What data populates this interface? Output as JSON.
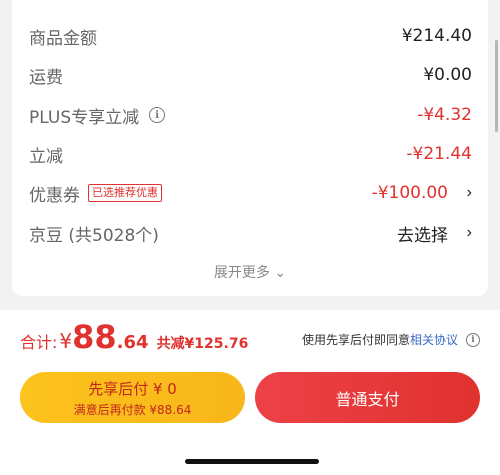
{
  "summary": {
    "rows": [
      {
        "label": "商品金额",
        "value": "¥214.40"
      },
      {
        "label": "运费",
        "value": "¥0.00"
      },
      {
        "label": "PLUS专享立减",
        "value": "-¥4.32"
      },
      {
        "label": "立减",
        "value": "-¥21.44"
      },
      {
        "label": "优惠券",
        "badge": "已选推荐优惠",
        "value": "-¥100.00",
        "chevron": "›"
      },
      {
        "label": "京豆 (共5028个)",
        "value": "去选择",
        "chevron": "›"
      }
    ],
    "expand_label": "展开更多 ⌄"
  },
  "footer": {
    "total_label": "合计:",
    "currency": "¥",
    "total_int": "88",
    "total_dec": ".64",
    "saved_text": "共减¥125.76",
    "agree_prefix": "使用先享后付即同意",
    "agree_link": "相关协议",
    "pay_later_title": "先享后付 ¥ 0",
    "pay_later_sub": "满意后再付款 ¥88.64",
    "normal_pay_label": "普通支付"
  },
  "icons": {
    "info": "info-icon",
    "chevron": "chevron-right-icon"
  },
  "colors": {
    "accent_red": "#e0322e",
    "pay_later_yellow": "#fcc21d",
    "link_blue": "#3a6bc4"
  }
}
